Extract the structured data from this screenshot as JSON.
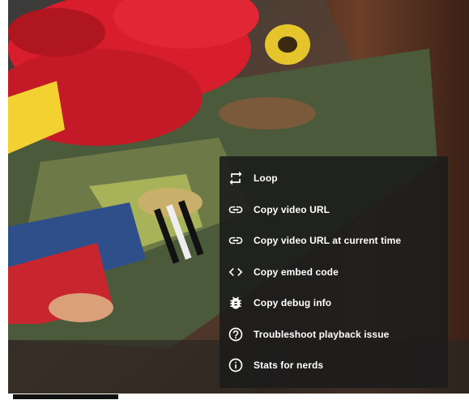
{
  "context_menu": {
    "items": [
      {
        "label": "Loop",
        "icon": "loop-icon"
      },
      {
        "label": "Copy video URL",
        "icon": "link-icon"
      },
      {
        "label": "Copy video URL at current time",
        "icon": "link-icon"
      },
      {
        "label": "Copy embed code",
        "icon": "code-icon"
      },
      {
        "label": "Copy debug info",
        "icon": "bug-icon"
      },
      {
        "label": "Troubleshoot playback issue",
        "icon": "help-icon"
      },
      {
        "label": "Stats for nerds",
        "icon": "info-icon"
      }
    ]
  },
  "colors": {
    "menu_background": "#1c1c1c",
    "menu_text": "#ffffff",
    "accent_red": "#d81e2c",
    "accent_yellow": "#f2d130"
  }
}
